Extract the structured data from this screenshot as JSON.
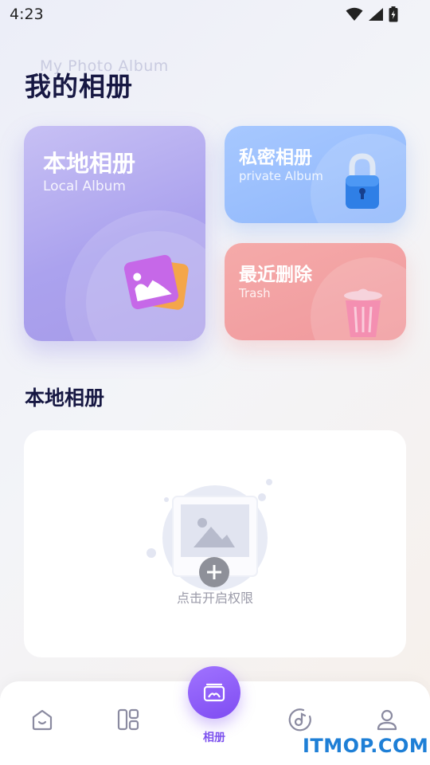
{
  "status_bar": {
    "time": "4:23",
    "icons": [
      "wifi-icon",
      "signal-icon",
      "battery-icon"
    ]
  },
  "header": {
    "subtitle": "My Photo Album",
    "title": "我的相册"
  },
  "cards": {
    "local": {
      "title": "本地相册",
      "subtitle": "Local Album",
      "icon": "photo-stack-icon",
      "color": "#aba2ee"
    },
    "private": {
      "title": "私密相册",
      "subtitle": "private Album",
      "icon": "padlock-icon",
      "color": "#8fb7fb"
    },
    "trash": {
      "title": "最近删除",
      "subtitle": "Trash",
      "icon": "trash-can-icon",
      "color": "#f0999d"
    }
  },
  "section": {
    "title": "本地相册"
  },
  "empty_state": {
    "icon": "add-photo-icon",
    "text": "点击开启权限"
  },
  "bottom_nav": {
    "items": [
      {
        "icon": "home-icon"
      },
      {
        "icon": "layout-grid-icon"
      },
      {
        "icon": "album-icon",
        "label": "相册",
        "active": true
      },
      {
        "icon": "music-disc-icon"
      },
      {
        "icon": "profile-icon"
      }
    ],
    "accent": "#7f4cf2"
  },
  "watermark": "ITMOP.COM"
}
